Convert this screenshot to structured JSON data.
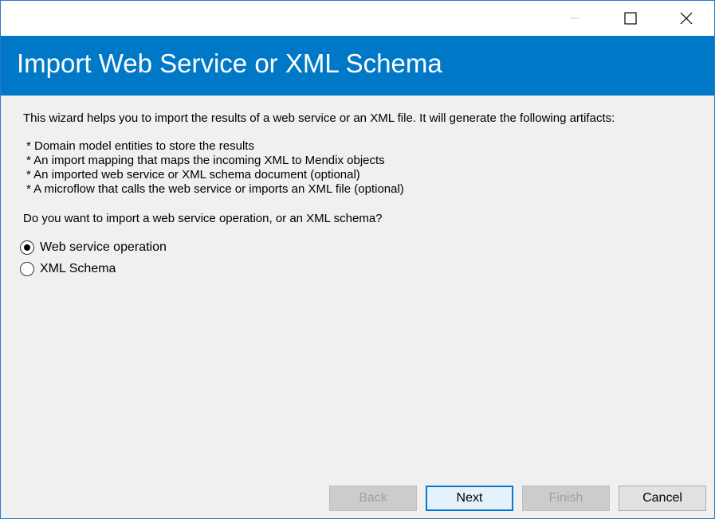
{
  "window": {
    "title": "Import Web Service or XML Schema",
    "controls": {
      "minimize_icon": "minimize-icon",
      "maximize_icon": "maximize-icon",
      "close_icon": "close-icon"
    }
  },
  "content": {
    "intro": "This wizard helps you to import the results of a web service or an XML file. It will generate the following artifacts:",
    "artifacts": [
      "* Domain model entities to store the results",
      "* An import mapping that maps the incoming XML to Mendix objects",
      "* An imported web service or XML schema document (optional)",
      "* A microflow that calls the web service or imports an XML file (optional)"
    ],
    "question": "Do you want to import a web service operation, or an XML schema?",
    "options": [
      {
        "label": "Web service operation",
        "selected": true
      },
      {
        "label": "XML Schema",
        "selected": false
      }
    ]
  },
  "buttons": {
    "back": {
      "label": "Back",
      "enabled": false
    },
    "next": {
      "label": "Next",
      "enabled": true
    },
    "finish": {
      "label": "Finish",
      "enabled": false
    },
    "cancel": {
      "label": "Cancel",
      "enabled": true
    }
  },
  "colors": {
    "banner": "#0078c8",
    "background": "#f0f0f0",
    "default_button_border": "#0078d7"
  }
}
